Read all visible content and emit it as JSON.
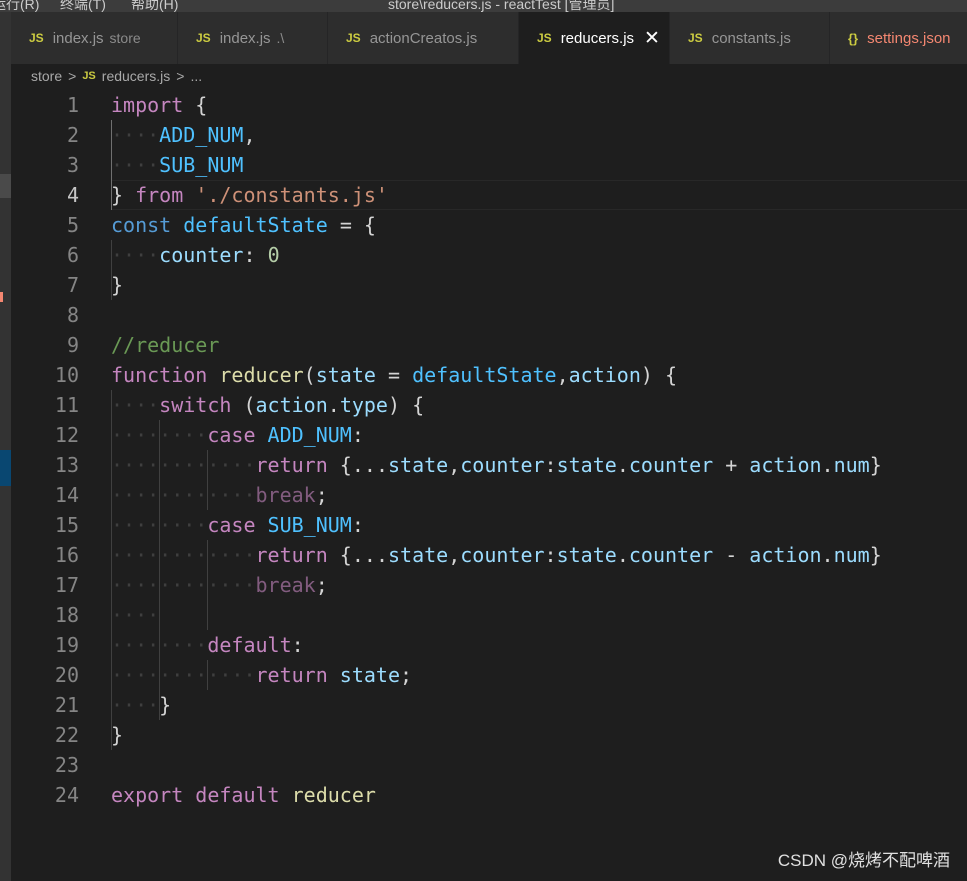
{
  "window": {
    "menu_left": "运行(R)",
    "menu_terminal": "终端(T)",
    "menu_help": "帮助(H)",
    "title": "store\\reducers.js - reactTest [管理员]"
  },
  "tabs": [
    {
      "icon": "JS",
      "label": "index.js",
      "desc": "store"
    },
    {
      "icon": "JS",
      "label": "index.js",
      "desc": ".\\"
    },
    {
      "icon": "JS",
      "label": "actionCreatos.js",
      "desc": ""
    },
    {
      "icon": "JS",
      "label": "reducers.js",
      "desc": "",
      "close": "✕"
    },
    {
      "icon": "JS",
      "label": "constants.js",
      "desc": ""
    },
    {
      "icon": "{}",
      "label": "settings.json",
      "desc": ""
    }
  ],
  "breadcrumb": {
    "folder": "store",
    "sep": ">",
    "file_icon": "JS",
    "file": "reducers.js",
    "more": "..."
  },
  "code": {
    "lines": [
      {
        "num": "1",
        "text": "import {"
      },
      {
        "num": "2",
        "text": "    ADD_NUM,"
      },
      {
        "num": "3",
        "text": "    SUB_NUM"
      },
      {
        "num": "4",
        "text": "} from './constants.js'"
      },
      {
        "num": "5",
        "text": "const defaultState = {"
      },
      {
        "num": "6",
        "text": "    counter: 0"
      },
      {
        "num": "7",
        "text": "}"
      },
      {
        "num": "8",
        "text": ""
      },
      {
        "num": "9",
        "text": "//reducer"
      },
      {
        "num": "10",
        "text": "function reducer(state = defaultState,action) {"
      },
      {
        "num": "11",
        "text": "    switch (action.type) {"
      },
      {
        "num": "12",
        "text": "        case ADD_NUM:"
      },
      {
        "num": "13",
        "text": "            return {...state,counter:state.counter + action.num}"
      },
      {
        "num": "14",
        "text": "            break;"
      },
      {
        "num": "15",
        "text": "        case SUB_NUM:"
      },
      {
        "num": "16",
        "text": "            return {...state,counter:state.counter - action.num}"
      },
      {
        "num": "17",
        "text": "            break;"
      },
      {
        "num": "18",
        "text": "    "
      },
      {
        "num": "19",
        "text": "        default:"
      },
      {
        "num": "20",
        "text": "            return state;"
      },
      {
        "num": "21",
        "text": "    }"
      },
      {
        "num": "22",
        "text": "}"
      },
      {
        "num": "23",
        "text": ""
      },
      {
        "num": "24",
        "text": "export default reducer"
      }
    ]
  },
  "watermark": "CSDN @烧烤不配啤酒",
  "colors": {
    "editor_bg": "#1e1e1e",
    "keyword_control": "#c586c0",
    "keyword": "#569cd6",
    "variable": "#9cdcfe",
    "constant": "#4fc1ff",
    "function": "#dcdcaa",
    "string": "#ce9178",
    "number": "#b5cea8",
    "comment": "#6a9955",
    "js_icon": "#cbcb41"
  }
}
